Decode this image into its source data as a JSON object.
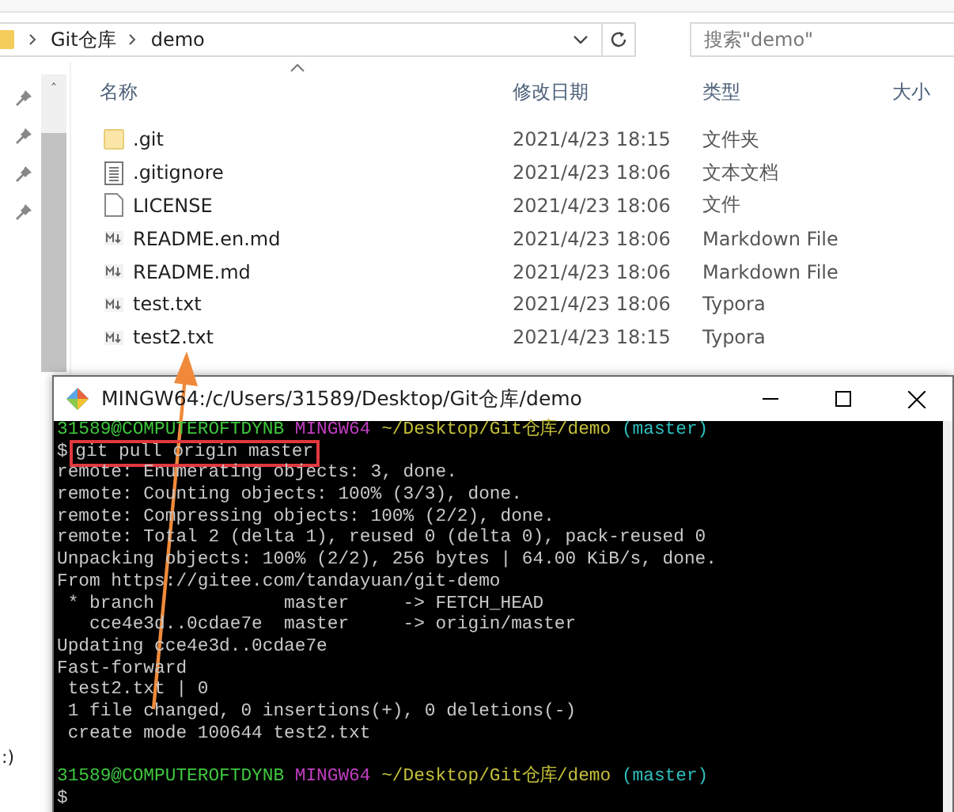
{
  "explorer": {
    "breadcrumb": [
      "Git仓库",
      "demo"
    ],
    "search": {
      "placeholder": "搜索\"demo\""
    },
    "columns": [
      "名称",
      "修改日期",
      "类型",
      "大小"
    ],
    "files": [
      {
        "kind": "folder",
        "name": ".git",
        "modified": "2021/4/23 18:15",
        "type": "文件夹"
      },
      {
        "kind": "text",
        "name": ".gitignore",
        "modified": "2021/4/23 18:06",
        "type": "文本文档"
      },
      {
        "kind": "blank",
        "name": "LICENSE",
        "modified": "2021/4/23 18:06",
        "type": "文件"
      },
      {
        "kind": "markdown",
        "name": "README.en.md",
        "modified": "2021/4/23 18:06",
        "type": "Markdown File"
      },
      {
        "kind": "markdown",
        "name": "README.md",
        "modified": "2021/4/23 18:06",
        "type": "Markdown File"
      },
      {
        "kind": "markdown",
        "name": "test.txt",
        "modified": "2021/4/23 18:06",
        "type": "Typora"
      },
      {
        "kind": "markdown",
        "name": "test2.txt",
        "modified": "2021/4/23 18:15",
        "type": "Typora"
      }
    ],
    "nav_label": ":)"
  },
  "terminal": {
    "title": "MINGW64:/c/Users/31589/Desktop/Git仓库/demo",
    "lines": [
      {
        "kind": "prompt",
        "user": "31589@COMPUTEROFTDYNB",
        "shell": "MINGW64",
        "path": "~/Desktop/Git仓库/demo",
        "branch": "(master)"
      },
      {
        "kind": "command",
        "prompt": "$",
        "text": "git pull origin master",
        "highlighted": true
      },
      {
        "kind": "output",
        "text": "remote: Enumerating objects: 3, done."
      },
      {
        "kind": "output",
        "text": "remote: Counting objects: 100% (3/3), done."
      },
      {
        "kind": "output",
        "text": "remote: Compressing objects: 100% (2/2), done."
      },
      {
        "kind": "output",
        "text": "remote: Total 2 (delta 1), reused 0 (delta 0), pack-reused 0"
      },
      {
        "kind": "output",
        "text": "Unpacking objects: 100% (2/2), 256 bytes | 64.00 KiB/s, done."
      },
      {
        "kind": "output",
        "text": "From https://gitee.com/tandayuan/git-demo"
      },
      {
        "kind": "output",
        "text": " * branch            master     -> FETCH_HEAD"
      },
      {
        "kind": "output",
        "text": "   cce4e3d..0cdae7e  master     -> origin/master"
      },
      {
        "kind": "output",
        "text": "Updating cce4e3d..0cdae7e"
      },
      {
        "kind": "output",
        "text": "Fast-forward"
      },
      {
        "kind": "output",
        "text": " test2.txt | 0"
      },
      {
        "kind": "output",
        "text": " 1 file changed, 0 insertions(+), 0 deletions(-)"
      },
      {
        "kind": "output",
        "text": " create mode 100644 test2.txt"
      },
      {
        "kind": "blank"
      },
      {
        "kind": "prompt",
        "user": "31589@COMPUTEROFTDYNB",
        "shell": "MINGW64",
        "path": "~/Desktop/Git仓库/demo",
        "branch": "(master)"
      },
      {
        "kind": "cursor",
        "prompt": "$"
      }
    ]
  }
}
